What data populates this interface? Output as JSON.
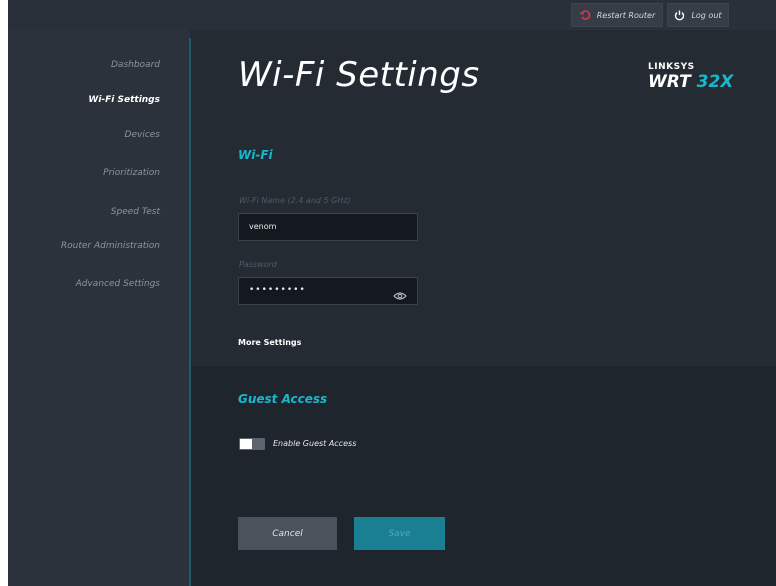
{
  "header": {
    "restart_label": "Restart Router",
    "logout_label": "Log out"
  },
  "sidebar": {
    "items": [
      {
        "label": "Dashboard"
      },
      {
        "label": "Wi-Fi Settings"
      },
      {
        "label": "Devices"
      },
      {
        "label": "Prioritization"
      },
      {
        "label": "Speed Test"
      },
      {
        "label": "Router Administration"
      },
      {
        "label": "Advanced Settings"
      }
    ],
    "active_index": 1
  },
  "main": {
    "title": "Wi-Fi Settings",
    "logo": {
      "brand": "LINKSYS",
      "model_a": "WRT",
      "model_b": "32X"
    },
    "wifi": {
      "section_title": "Wi-Fi",
      "name_label": "Wi-Fi Name (2.4 and 5 GHz)",
      "name_value": "venom",
      "password_label": "Password",
      "password_mask": "•••••••••"
    },
    "more_settings": "More Settings",
    "guest": {
      "section_title": "Guest Access",
      "toggle_label": "Enable Guest Access",
      "enabled": false
    },
    "actions": {
      "cancel": "Cancel",
      "save": "Save"
    }
  },
  "colors": {
    "accent": "#19b7cc",
    "background": "#252b33",
    "save_button": "#1a7f92"
  },
  "icons": [
    "restart-icon",
    "power-icon",
    "eye-icon"
  ]
}
